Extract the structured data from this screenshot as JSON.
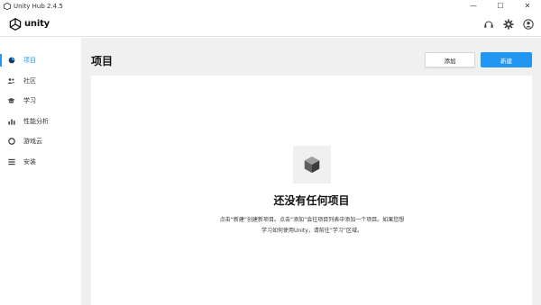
{
  "window": {
    "title": "Unity Hub 2.4.5",
    "controls": [
      "—",
      "☐",
      "✕"
    ]
  },
  "header": {
    "logo_text": "unity",
    "icons": [
      "support-icon",
      "settings-gear-icon",
      "account-icon"
    ]
  },
  "sidebar": {
    "items": [
      {
        "label": "项目",
        "icon": "projects-icon",
        "active": true
      },
      {
        "label": "社区",
        "icon": "community-icon",
        "active": false
      },
      {
        "label": "学习",
        "icon": "learn-icon",
        "active": false
      },
      {
        "label": "性能分析",
        "icon": "analytics-icon",
        "active": false
      },
      {
        "label": "游戏云",
        "icon": "cloud-icon",
        "active": false
      },
      {
        "label": "安装",
        "icon": "installs-icon",
        "active": false
      }
    ]
  },
  "main": {
    "title": "项目",
    "add_button": "添加",
    "new_button": "新建",
    "empty_state": {
      "icon": "cube-icon",
      "title": "还没有任何项目",
      "description": "点击“新建”创建新项目。点击“添加”会往项目列表中添加一个项目。如果您想学习如何使用Unity，请前往“学习”区域。"
    }
  },
  "colors": {
    "accent": "#2196f3",
    "background": "#f0f0f0",
    "panel": "#ffffff"
  }
}
